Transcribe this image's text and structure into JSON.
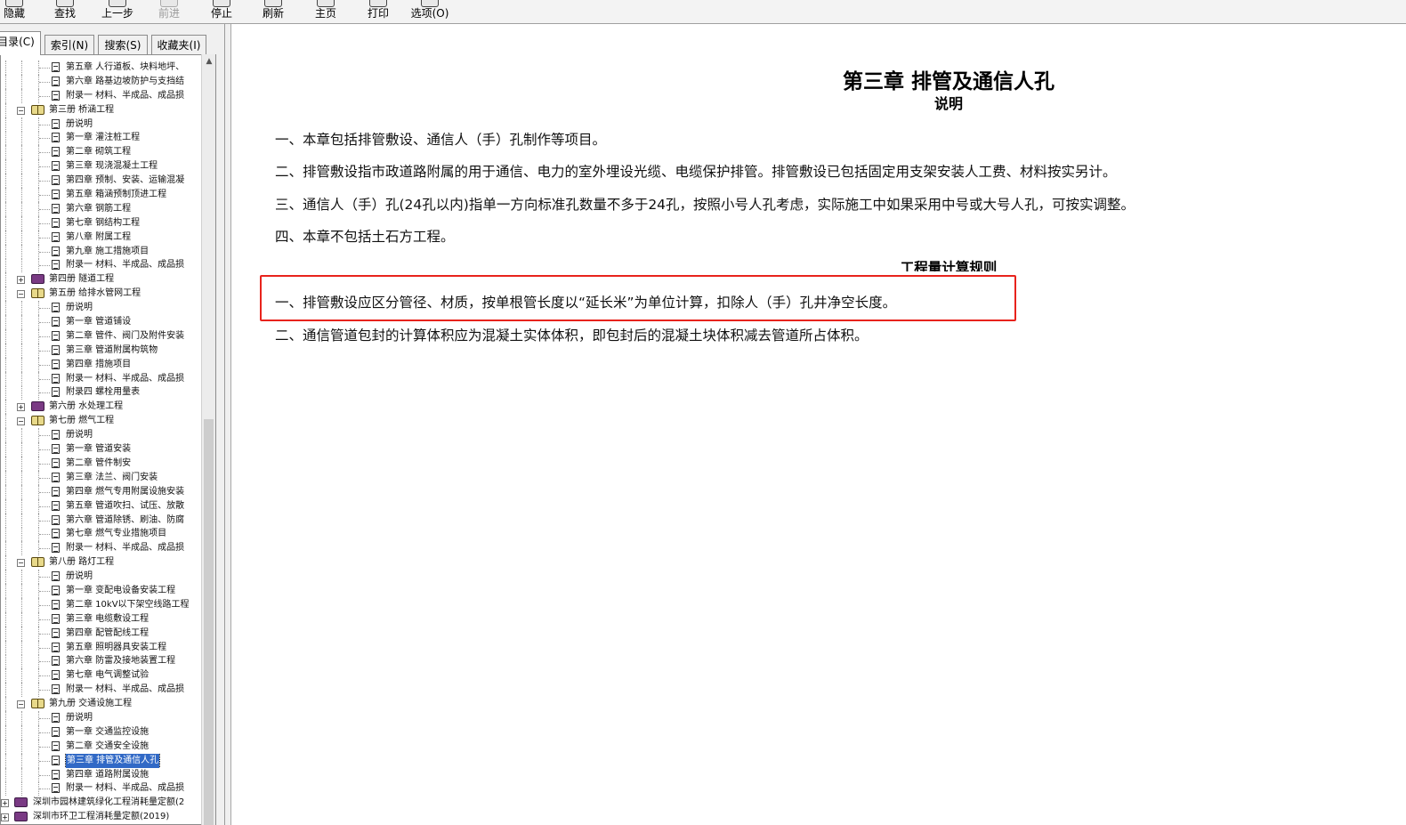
{
  "toolbar": {
    "buttons": [
      {
        "label": "隐藏",
        "enabled": true
      },
      {
        "label": "查找",
        "enabled": true
      },
      {
        "label": "上一步",
        "enabled": true
      },
      {
        "label": "前进",
        "enabled": false
      },
      {
        "label": "停止",
        "enabled": true
      },
      {
        "label": "刷新",
        "enabled": true
      },
      {
        "label": "主页",
        "enabled": true
      },
      {
        "label": "打印",
        "enabled": true
      },
      {
        "label": "选项(O)",
        "enabled": true
      }
    ]
  },
  "nav": {
    "tabs": [
      {
        "label": "目录(C)",
        "active": true
      },
      {
        "label": "索引(N)",
        "active": false
      },
      {
        "label": "搜索(S)",
        "active": false
      },
      {
        "label": "收藏夹(I)",
        "active": false
      }
    ],
    "tree": [
      {
        "level": 2,
        "kind": "doc",
        "label": "第五章  人行道板、块料地坪、"
      },
      {
        "level": 2,
        "kind": "doc",
        "label": "第六章  路基边坡防护与支挡结"
      },
      {
        "level": 2,
        "kind": "doc",
        "label": "附录一  材料、半成品、成品损"
      },
      {
        "level": 1,
        "kind": "book-open",
        "label": "第三册  桥涵工程"
      },
      {
        "level": 2,
        "kind": "doc",
        "label": "册说明"
      },
      {
        "level": 2,
        "kind": "doc",
        "label": "第一章  灌注桩工程"
      },
      {
        "level": 2,
        "kind": "doc",
        "label": "第二章  砌筑工程"
      },
      {
        "level": 2,
        "kind": "doc",
        "label": "第三章  现浇混凝土工程"
      },
      {
        "level": 2,
        "kind": "doc",
        "label": "第四章  预制、安装、运输混凝"
      },
      {
        "level": 2,
        "kind": "doc",
        "label": "第五章  箱涵预制顶进工程"
      },
      {
        "level": 2,
        "kind": "doc",
        "label": "第六章  钢筋工程"
      },
      {
        "level": 2,
        "kind": "doc",
        "label": "第七章  钢结构工程"
      },
      {
        "level": 2,
        "kind": "doc",
        "label": "第八章  附属工程"
      },
      {
        "level": 2,
        "kind": "doc",
        "label": "第九章  施工措施项目"
      },
      {
        "level": 2,
        "kind": "doc",
        "label": "附录一  材料、半成品、成品损"
      },
      {
        "level": 1,
        "kind": "book-closed",
        "label": "第四册  隧道工程"
      },
      {
        "level": 1,
        "kind": "book-open",
        "label": "第五册  给排水管网工程"
      },
      {
        "level": 2,
        "kind": "doc",
        "label": "册说明"
      },
      {
        "level": 2,
        "kind": "doc",
        "label": "第一章  管道铺设"
      },
      {
        "level": 2,
        "kind": "doc",
        "label": "第二章  管件、阀门及附件安装"
      },
      {
        "level": 2,
        "kind": "doc",
        "label": "第三章  管道附属构筑物"
      },
      {
        "level": 2,
        "kind": "doc",
        "label": "第四章  措施项目"
      },
      {
        "level": 2,
        "kind": "doc",
        "label": "附录一  材料、半成品、成品损"
      },
      {
        "level": 2,
        "kind": "doc",
        "label": "附录四  螺栓用量表"
      },
      {
        "level": 1,
        "kind": "book-closed",
        "label": "第六册  水处理工程"
      },
      {
        "level": 1,
        "kind": "book-open",
        "label": "第七册  燃气工程"
      },
      {
        "level": 2,
        "kind": "doc",
        "label": "册说明"
      },
      {
        "level": 2,
        "kind": "doc",
        "label": "第一章  管道安装"
      },
      {
        "level": 2,
        "kind": "doc",
        "label": "第二章  管件制安"
      },
      {
        "level": 2,
        "kind": "doc",
        "label": "第三章  法兰、阀门安装"
      },
      {
        "level": 2,
        "kind": "doc",
        "label": "第四章  燃气专用附属设施安装"
      },
      {
        "level": 2,
        "kind": "doc",
        "label": "第五章  管道吹扫、试压、放散"
      },
      {
        "level": 2,
        "kind": "doc",
        "label": "第六章  管道除锈、刷油、防腐"
      },
      {
        "level": 2,
        "kind": "doc",
        "label": "第七章  燃气专业措施项目"
      },
      {
        "level": 2,
        "kind": "doc",
        "label": "附录一  材料、半成品、成品损"
      },
      {
        "level": 1,
        "kind": "book-open",
        "label": "第八册  路灯工程"
      },
      {
        "level": 2,
        "kind": "doc",
        "label": "册说明"
      },
      {
        "level": 2,
        "kind": "doc",
        "label": "第一章  变配电设备安装工程"
      },
      {
        "level": 2,
        "kind": "doc",
        "label": "第二章  10kV以下架空线路工程"
      },
      {
        "level": 2,
        "kind": "doc",
        "label": "第三章  电缆敷设工程"
      },
      {
        "level": 2,
        "kind": "doc",
        "label": "第四章  配管配线工程"
      },
      {
        "level": 2,
        "kind": "doc",
        "label": "第五章  照明器具安装工程"
      },
      {
        "level": 2,
        "kind": "doc",
        "label": "第六章  防雷及接地装置工程"
      },
      {
        "level": 2,
        "kind": "doc",
        "label": "第七章  电气调整试验"
      },
      {
        "level": 2,
        "kind": "doc",
        "label": "附录一  材料、半成品、成品损"
      },
      {
        "level": 1,
        "kind": "book-open",
        "label": "第九册  交通设施工程"
      },
      {
        "level": 2,
        "kind": "doc",
        "label": "册说明"
      },
      {
        "level": 2,
        "kind": "doc",
        "label": "第一章  交通监控设施"
      },
      {
        "level": 2,
        "kind": "doc",
        "label": "第二章  交通安全设施"
      },
      {
        "level": 2,
        "kind": "doc",
        "label": "第三章  排管及通信人孔",
        "selected": true
      },
      {
        "level": 2,
        "kind": "doc",
        "label": "第四章  道路附属设施"
      },
      {
        "level": 2,
        "kind": "doc",
        "label": "附录一  材料、半成品、成品损"
      },
      {
        "level": 0,
        "kind": "book-closed",
        "label": "深圳市园林建筑绿化工程消耗量定额(2"
      },
      {
        "level": 0,
        "kind": "book-closed",
        "label": "深圳市环卫工程消耗量定额(2019)"
      }
    ]
  },
  "content": {
    "title": "第三章  排管及通信人孔",
    "subtitle": "说明",
    "paragraphs": [
      "一、本章包括排管敷设、通信人（手）孔制作等项目。",
      "二、排管敷设指市政道路附属的用于通信、电力的室外埋设光缆、电缆保护排管。排管敷设已包括固定用支架安装人工费、材料按实另计。",
      "三、通信人（手）孔(24孔以内)指单一方向标准孔数量不多于24孔，按照小号人孔考虑，实际施工中如果采用中号或大号人孔，可按实调整。",
      "四、本章不包括土石方工程。"
    ],
    "rules_heading": "工程量计算规则",
    "rules": [
      "一、排管敷设应区分管径、材质，按单根管长度以“延长米”为单位计算，扣除人（手）孔井净空长度。",
      "二、通信管道包封的计算体积应为混凝土实体体积，即包封后的混凝土块体积减去管道所占体积。"
    ]
  },
  "colors": {
    "highlight_border": "#e8231c",
    "selection_bg": "#3169c6",
    "toolbar_bg": "#f3f3f3",
    "pane_bg": "#f0f0f0"
  }
}
